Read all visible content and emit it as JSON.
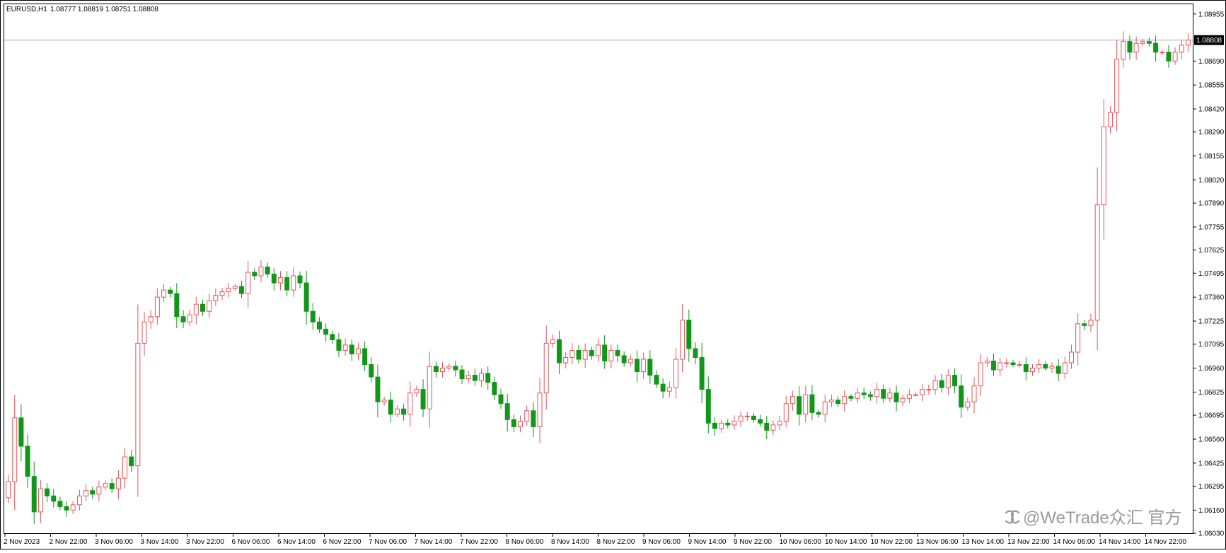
{
  "header": {
    "symbol_label": "EURUSD,H1",
    "ohlc_text": "1.08777 1.08819 1.08751 1.08808"
  },
  "watermark": {
    "text": "@WeTrade众汇 官方",
    "icon": "wechat-channel-icon"
  },
  "colors": {
    "bull": "#e8535b",
    "bear": "#109618",
    "price_line": "#a9a9a9",
    "axis": "#000000",
    "price_label_bg": "#000000",
    "price_label_fg": "#ffffff"
  },
  "chart_data": {
    "type": "candlestick",
    "title": "EURUSD,H1",
    "timeframe": "H1",
    "last_ohlc": {
      "open": 1.08777,
      "high": 1.08819,
      "low": 1.08751,
      "close": 1.08808
    },
    "current_price": 1.08808,
    "ylim": [
      1.0603,
      1.0901
    ],
    "y_ticks": [
      "1.08955",
      "1.08690",
      "1.08555",
      "1.08420",
      "1.08290",
      "1.08155",
      "1.08020",
      "1.07890",
      "1.07755",
      "1.07625",
      "1.07495",
      "1.07360",
      "1.07225",
      "1.07095",
      "1.06960",
      "1.06825",
      "1.06695",
      "1.06560",
      "1.06425",
      "1.06295",
      "1.06160",
      "1.06030"
    ],
    "x_ticks": [
      "2 Nov 2023",
      "2 Nov 22:00",
      "3 Nov 06:00",
      "3 Nov 14:00",
      "3 Nov 22:00",
      "6 Nov 06:00",
      "6 Nov 14:00",
      "6 Nov 22:00",
      "7 Nov 06:00",
      "7 Nov 14:00",
      "7 Nov 22:00",
      "8 Nov 06:00",
      "8 Nov 14:00",
      "8 Nov 22:00",
      "9 Nov 06:00",
      "9 Nov 14:00",
      "9 Nov 22:00",
      "10 Nov 06:00",
      "10 Nov 14:00",
      "10 Nov 22:00",
      "13 Nov 06:00",
      "13 Nov 14:00",
      "13 Nov 22:00",
      "14 Nov 06:00",
      "14 Nov 14:00",
      "14 Nov 22:00"
    ],
    "closes": [
      1.0632,
      1.0668,
      1.0652,
      1.0635,
      1.0615,
      1.0628,
      1.0624,
      1.0621,
      1.0618,
      1.0616,
      1.0619,
      1.0624,
      1.0627,
      1.0625,
      1.0629,
      1.0631,
      1.0628,
      1.0634,
      1.0646,
      1.0641,
      1.071,
      1.0722,
      1.0725,
      1.0736,
      1.074,
      1.0738,
      1.0725,
      1.0722,
      1.0726,
      1.0732,
      1.0728,
      1.0734,
      1.0737,
      1.0739,
      1.0741,
      1.0742,
      1.0738,
      1.075,
      1.0748,
      1.0753,
      1.0749,
      1.0744,
      1.0747,
      1.074,
      1.0748,
      1.0744,
      1.0728,
      1.0722,
      1.0718,
      1.0715,
      1.0712,
      1.0706,
      1.0709,
      1.0704,
      1.0707,
      1.0698,
      1.0691,
      1.0677,
      1.0678,
      1.067,
      1.0673,
      1.067,
      1.0682,
      1.0684,
      1.0673,
      1.0697,
      1.0694,
      1.0696,
      1.0697,
      1.0695,
      1.069,
      1.0692,
      1.0689,
      1.0693,
      1.0688,
      1.0681,
      1.0676,
      1.0667,
      1.0663,
      1.0666,
      1.0672,
      1.0663,
      1.0682,
      1.071,
      1.0712,
      1.0699,
      1.0702,
      1.0706,
      1.0701,
      1.0706,
      1.0703,
      1.0709,
      1.07,
      1.0706,
      1.0703,
      1.0699,
      1.0701,
      1.0694,
      1.0701,
      1.0692,
      1.0687,
      1.0683,
      1.0685,
      1.0701,
      1.0723,
      1.0707,
      1.0702,
      1.0684,
      1.0665,
      1.0662,
      1.0665,
      1.0664,
      1.0666,
      1.0669,
      1.0669,
      1.0667,
      1.0665,
      1.0661,
      1.0664,
      1.0666,
      1.0676,
      1.068,
      1.067,
      1.0681,
      1.0671,
      1.067,
      1.0677,
      1.0678,
      1.0676,
      1.068,
      1.0679,
      1.0682,
      1.0681,
      1.068,
      1.0684,
      1.0679,
      1.0682,
      1.0677,
      1.0679,
      1.0681,
      1.0681,
      1.0684,
      1.0684,
      1.0689,
      1.0685,
      1.0692,
      1.0686,
      1.0674,
      1.0677,
      1.0686,
      1.0699,
      1.07,
      1.0695,
      1.0699,
      1.0699,
      1.0698,
      1.0698,
      1.0694,
      1.0696,
      1.0698,
      1.0696,
      1.0697,
      1.0693,
      1.0699,
      1.0705,
      1.0721,
      1.072,
      1.0723,
      1.0788,
      1.0832,
      1.084,
      1.087,
      1.088,
      1.0874,
      1.0879,
      1.088,
      1.0879,
      1.0874,
      1.0874,
      1.0869,
      1.0874,
      1.0878,
      1.08808
    ]
  }
}
